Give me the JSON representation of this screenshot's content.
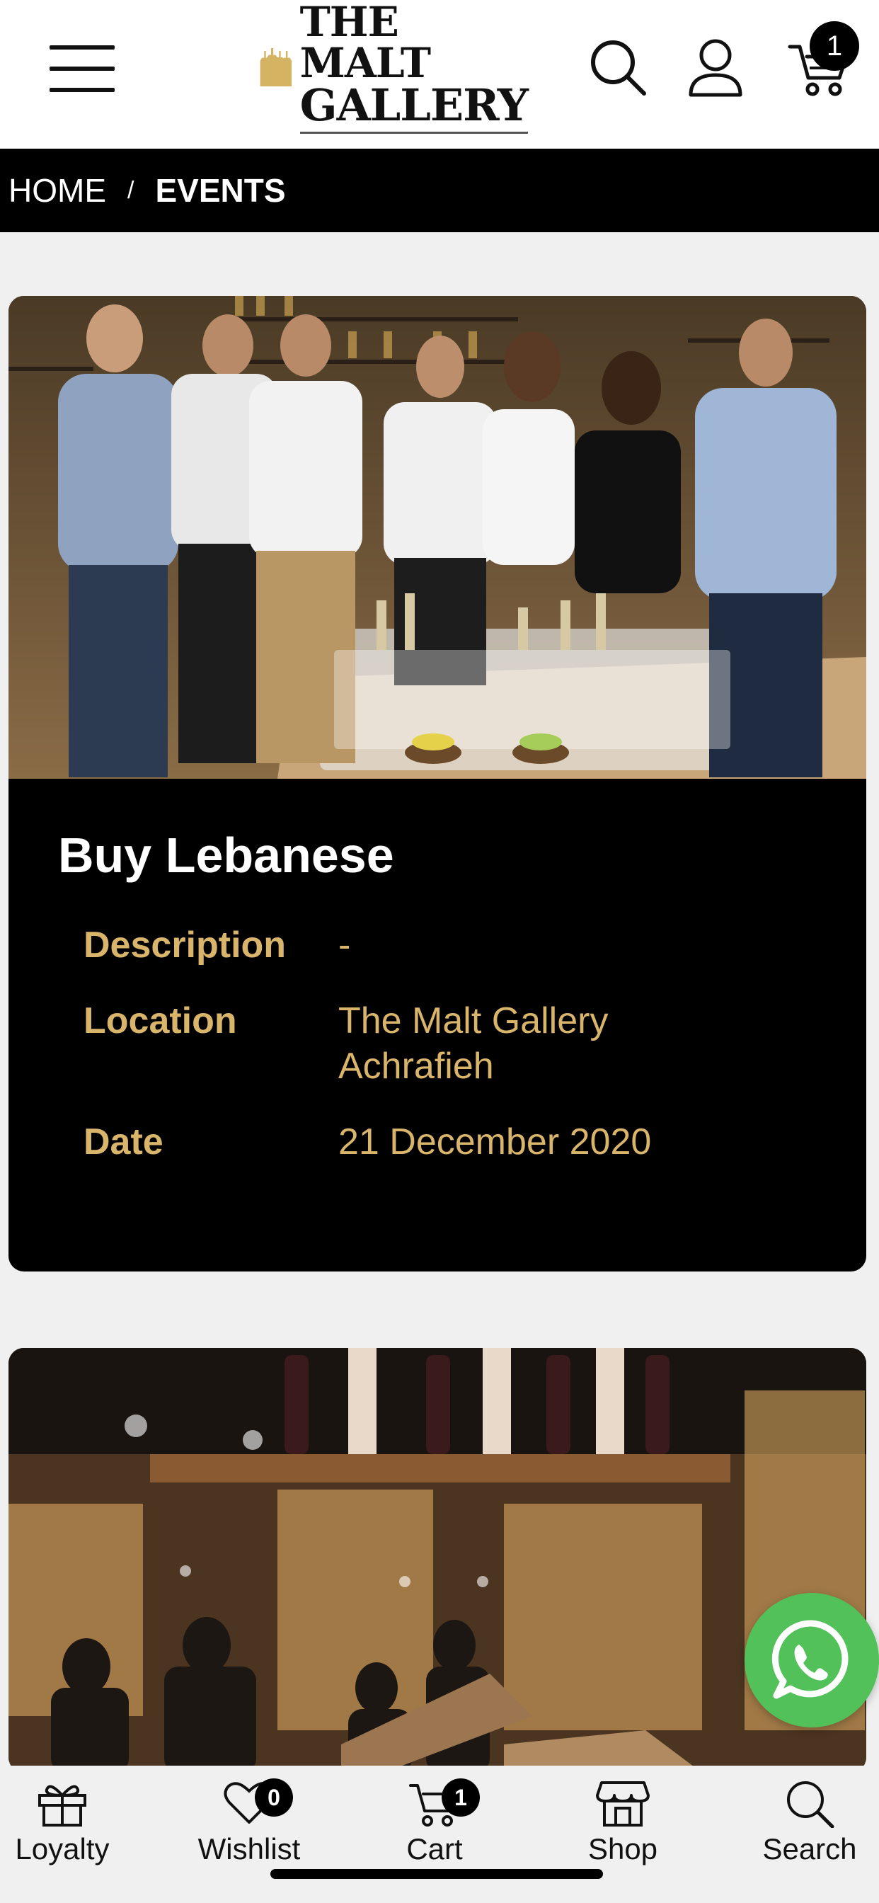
{
  "header": {
    "logo_line1": "THE MALT",
    "logo_line2": "GALLERY",
    "cart_count": "1",
    "icons": [
      "menu-icon",
      "search-icon",
      "user-icon",
      "cart-icon"
    ]
  },
  "breadcrumb": {
    "home": "HOME",
    "separator": "/",
    "current": "EVENTS"
  },
  "events": [
    {
      "title": "Buy Lebanese",
      "description_label": "Description",
      "description_value": "-",
      "location_label": "Location",
      "location_value_line1": "The Malt Gallery",
      "location_value_line2": "Achrafieh",
      "date_label": "Date",
      "date_value": "21 December 2020"
    }
  ],
  "bottom_nav": {
    "loyalty": "Loyalty",
    "wishlist": "Wishlist",
    "wishlist_count": "0",
    "cart": "Cart",
    "cart_count": "1",
    "shop": "Shop",
    "search": "Search"
  },
  "colors": {
    "accent_gold": "#d9b56b",
    "whatsapp_green": "#53c15a",
    "background": "#f0f0f0",
    "card_bg": "#000000"
  }
}
